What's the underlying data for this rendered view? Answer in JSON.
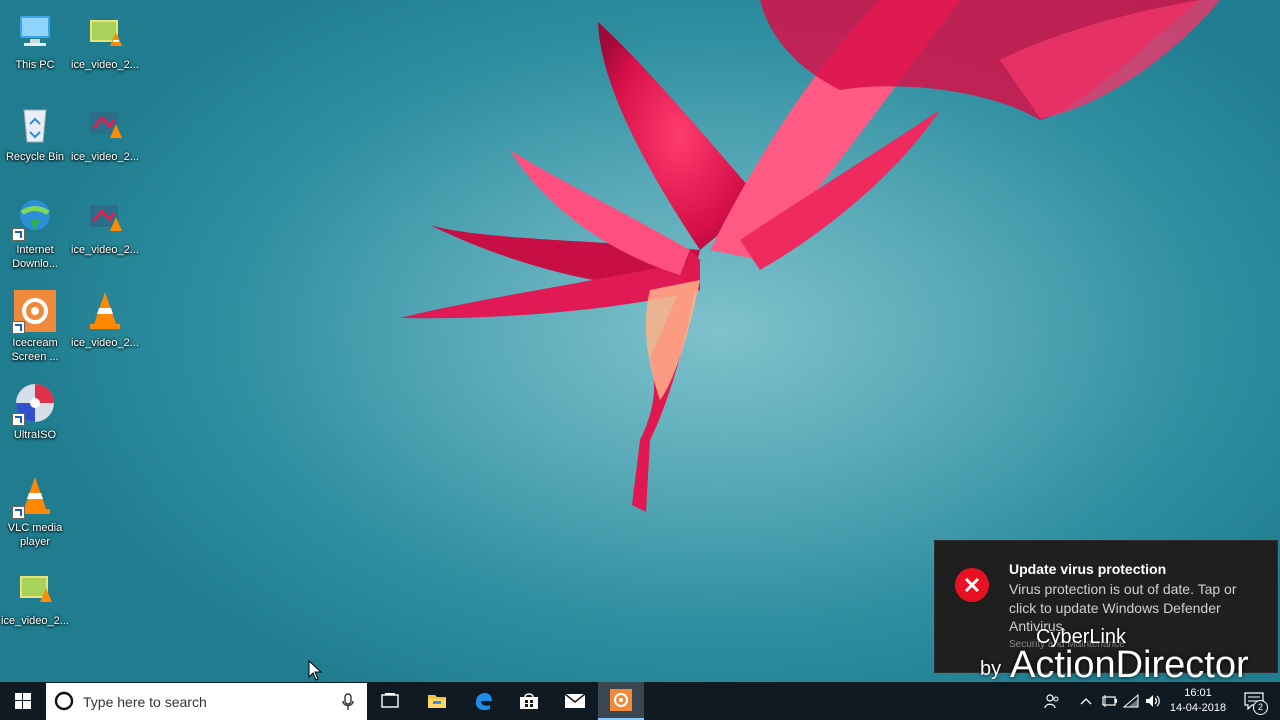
{
  "desktop": {
    "icons": [
      {
        "label": "This PC"
      },
      {
        "label": "ice_video_2..."
      },
      {
        "label": "Recycle Bin"
      },
      {
        "label": "ice_video_2..."
      },
      {
        "label": "Internet Downlo..."
      },
      {
        "label": "ice_video_2..."
      },
      {
        "label": "Icecream Screen ..."
      },
      {
        "label": "ice_video_2..."
      },
      {
        "label": "UltraISO"
      },
      {
        "label": "VLC media player"
      },
      {
        "label": "ice_video_2..."
      }
    ]
  },
  "notification": {
    "icon": "error-x-icon",
    "title": "Update virus protection",
    "body": "Virus protection is out of date. Tap or click to update Windows Defender Antivirus.",
    "source": "Security and Maintenance",
    "accent": "#e81123"
  },
  "watermark": {
    "line1": "CyberLink",
    "line2": "by",
    "line3": "ActionDirector"
  },
  "taskbar": {
    "start_icon": "windows-logo-icon",
    "search_placeholder": "Type here to search",
    "pinned": [
      "task-view-icon",
      "file-explorer-icon",
      "edge-icon",
      "store-icon",
      "mail-icon",
      "icecream-recorder-icon"
    ],
    "tray_icons": [
      "people-icon",
      "chevron-up-icon",
      "power-icon",
      "wifi-icon",
      "volume-icon"
    ],
    "time": "16:01",
    "date": "14-04-2018",
    "action_center_count": "2",
    "background": "#0f1a22"
  }
}
